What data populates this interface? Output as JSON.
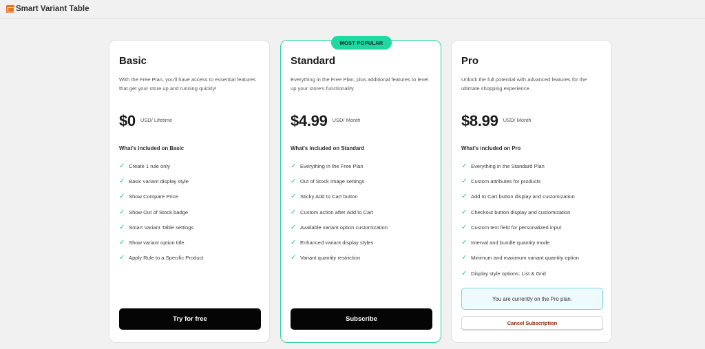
{
  "app": {
    "title": "Smart Variant Table",
    "icon": "app-table-icon",
    "accent_color": "#e8731d"
  },
  "plans": [
    {
      "name": "Basic",
      "description": "With the Free Plan, you'll have access to essential features that get your store up and running quickly!",
      "price": "$0",
      "period": "USD/ Lifetime",
      "included_title": "What's included on Basic",
      "features": [
        "Create 1 rule only",
        "Basic variant display style",
        "Show Compare Price",
        "Show Out of Stock badge",
        "Smart Variant Table settings",
        "Show variant option title",
        "Apply Rule to a Specific Product"
      ],
      "cta": "Try for free"
    },
    {
      "name": "Standard",
      "badge": "MOST POPULAR",
      "badge_color": "#1fd9a2",
      "description": "Everything in the Free Plan, plus additional features to level up your store's functionality.",
      "price": "$4.99",
      "period": "USD/ Month",
      "included_title": "What's included on Standard",
      "features": [
        "Everything in the Free Plan",
        "Out of Stock Image settings",
        "Sticky Add to Cart button",
        "Custom action after Add to Cart",
        "Available variant option customization",
        "Enhanced variant display styles",
        "Variant quantity restriction"
      ],
      "cta": "Subscribe"
    },
    {
      "name": "Pro",
      "description": "Unlock the full potential with advanced features for the ultimate shopping experience.",
      "price": "$8.99",
      "period": "USD/ Month",
      "included_title": "What's included on Pro",
      "features": [
        "Everything in the Standard Plan",
        "Custom attributes for products",
        "Add to Cart button display and customization",
        "Checkout button display and customization",
        "Custom text field for personalized input",
        "Interval and bundle quantity mode",
        "Minimum and maximum variant quantity option",
        "Display style options: List & Grid"
      ],
      "current_notice": "You are currently on the Pro plan.",
      "cancel_label": "Cancel Subscription"
    }
  ],
  "check_icon": "check-icon",
  "check_color": "#2bc495"
}
